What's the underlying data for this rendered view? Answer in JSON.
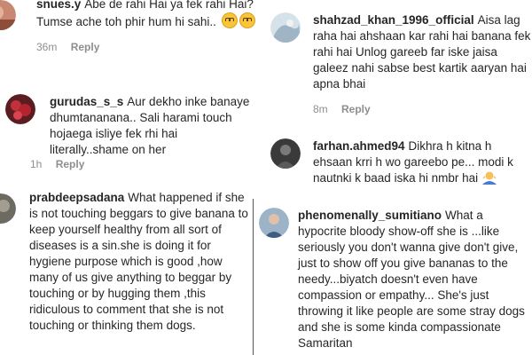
{
  "comments": [
    {
      "id": "c1",
      "username": "snues.y",
      "text": "Abe de rahi Hai ya fek rahi Hai? Tumse ache toh phir hum hi sahi..",
      "time": "36m",
      "reply": "Reply",
      "emoji": "relieved-face-emoji"
    },
    {
      "id": "c2",
      "username": "shahzad_khan_1996_official",
      "text": "Aisa lag raha hai ahshaan kar rahi hai banana fek rahi hai Unlog gareeb far iske jaisa galeez nahi sabse best kartik aaryan hai apna bhai",
      "time": "8m",
      "reply": "Reply"
    },
    {
      "id": "c3",
      "username": "gurudas_s_s",
      "text": "Aur dekho inke banaye dhumtananana.. Sali harami touch hojaega isliye fek rhi hai literally..shame on her",
      "time": "1h",
      "reply": "Reply"
    },
    {
      "id": "c4",
      "username": "farhan.ahmed94",
      "text": "Dikhra h kitna h ehsaan krri h wo gareebo pe... modi k nautnki k baad iska hi nmbr hai",
      "emoji": "person-shrugging-emoji"
    },
    {
      "id": "c5",
      "username": "prabdeepsadana",
      "text": "What happened if she is not touching beggars to give banana to keep yourself healthy from all sort of diseases is a sin.she is doing it for hygiene purpose which is good ,how many of us give anything to beggar by touching or by hugging them ,this ridiculous to comment that she is not touching or thinking them dogs."
    },
    {
      "id": "c6",
      "username": "phenomenally_sumitiano",
      "text": "What a hypocrite bloody show-off she is ...like seriously you don't wanna give don't give, just to show off you give bananas to the needy...biyatch doesn't even have compassion or empathy... She's just throwing it like people are some stray dogs and she is some kinda compassionate Samaritan"
    }
  ],
  "colors": {
    "text": "#262626",
    "meta": "#8e8e8e",
    "divider": "#555555"
  }
}
